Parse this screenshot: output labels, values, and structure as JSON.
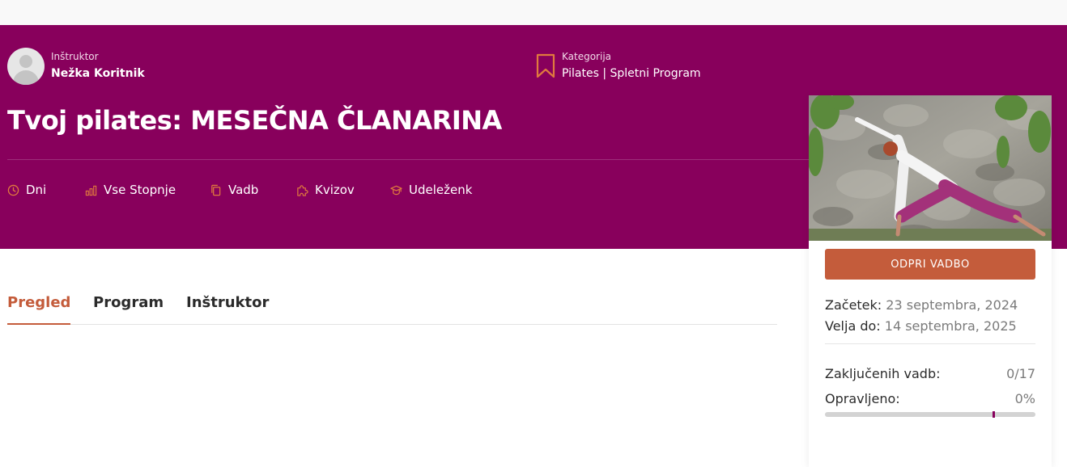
{
  "header": {
    "instructor_label": "Inštruktor",
    "instructor_name": "Nežka Koritnik",
    "category_label": "Kategorija",
    "category_value": "Pilates | Spletni Program",
    "title": "Tvoj pilates: MESEČNA ČLANARINA"
  },
  "stats": [
    {
      "icon": "clock-icon",
      "label": "Dni"
    },
    {
      "icon": "bar-chart-icon",
      "label": "Vse Stopnje"
    },
    {
      "icon": "copy-icon",
      "label": "Vadb"
    },
    {
      "icon": "puzzle-icon",
      "label": "Kvizov"
    },
    {
      "icon": "graduation-cap-icon",
      "label": "Udeleženk"
    }
  ],
  "tabs": [
    {
      "label": "Pregled",
      "active": true
    },
    {
      "label": "Program",
      "active": false
    },
    {
      "label": "Inštruktor",
      "active": false
    }
  ],
  "sidebar": {
    "button_label": "ODPRI VADBO",
    "start_label": "Začetek:",
    "start_value": "23 septembra, 2024",
    "end_label": "Velja do:",
    "end_value": "14 septembra, 2025",
    "completed_label": "Zaključenih vadb:",
    "completed_value": "0/17",
    "done_label": "Opravljeno:",
    "done_value": "0%",
    "progress_fraction": 0
  },
  "colors": {
    "hero_bg": "#88005c",
    "accent": "#c45c3b",
    "icon_accent": "#e07a3e"
  }
}
